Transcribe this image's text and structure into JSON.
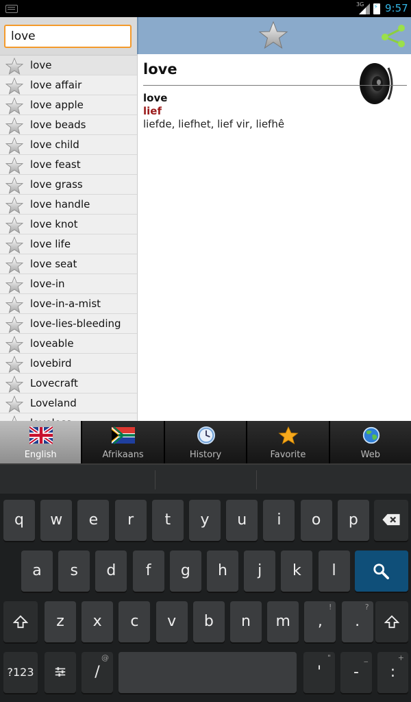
{
  "status_bar": {
    "time": "9:57",
    "network": "3G"
  },
  "search": {
    "value": "love",
    "placeholder": ""
  },
  "word_list": [
    "love",
    "love affair",
    "love apple",
    "love beads",
    "love child",
    "love feast",
    "love grass",
    "love handle",
    "love knot",
    "love life",
    "love seat",
    "love-in",
    "love-in-a-mist",
    "love-lies-bleeding",
    "loveable",
    "lovebird",
    "Lovecraft",
    "Loveland",
    "loveless"
  ],
  "entry": {
    "title": "love",
    "headword": "love",
    "translation": "lief",
    "definition": "liefde, liefhet, lief vir, liefhê"
  },
  "tabs": [
    {
      "label": "English",
      "icon": "uk-flag-icon",
      "active": true
    },
    {
      "label": "Afrikaans",
      "icon": "south-africa-flag-icon",
      "active": false
    },
    {
      "label": "History",
      "icon": "clock-icon",
      "active": false
    },
    {
      "label": "Favorite",
      "icon": "star-icon",
      "active": false
    },
    {
      "label": "Web",
      "icon": "globe-icon",
      "active": false
    }
  ],
  "keyboard": {
    "row1": [
      "q",
      "w",
      "e",
      "r",
      "t",
      "y",
      "u",
      "i",
      "o",
      "p"
    ],
    "row2": [
      "a",
      "s",
      "d",
      "f",
      "g",
      "h",
      "j",
      "k",
      "l"
    ],
    "row3": [
      "z",
      "x",
      "c",
      "v",
      "b",
      "n",
      "m",
      ",",
      "."
    ],
    "row3_hints": [
      "",
      "",
      "",
      "",
      "",
      "",
      "",
      "!",
      "?"
    ],
    "row4": {
      "sym": "?123",
      "slash": "/",
      "slash_hint": "@",
      "apostrophe": "'",
      "apostrophe_hint": "\"",
      "dash": "-",
      "dash_hint": "_",
      "colon": ":",
      "colon_hint": "+"
    }
  },
  "colors": {
    "accent": "#33b5e5",
    "header": "#8aaacb",
    "search_border": "#f49a2a",
    "translation": "#9b1c1c",
    "search_key": "#0f4f79"
  }
}
